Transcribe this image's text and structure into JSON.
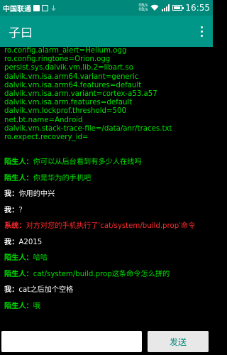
{
  "status_bar": {
    "carrier": "中国联通",
    "network_rate_top": "0B/s",
    "network_rate_bottom": "0B/s",
    "time": "16:55",
    "icons": [
      "check-square-icon",
      "check-square-icon",
      "usb-icon",
      "wifi-icon",
      "signal-icon",
      "battery-icon"
    ]
  },
  "app_bar": {
    "title": "子曰"
  },
  "props_lines": [
    "ro.config.alarm_alert=Helium.ogg",
    "ro.config.ringtone=Orion.ogg",
    "persist.sys.dalvik.vm.lib.2=libart.so",
    "dalvik.vm.isa.arm64.variant=generic",
    "dalvik.vm.isa.arm64.features=default",
    "dalvik.vm.isa.arm.variant=cortex-a53.a57",
    "dalvik.vm.isa.arm.features=default",
    "dalvik.vm.lockprof.threshold=500",
    "net.bt.name=Android",
    "dalvik.vm.stack-trace-file=/data/anr/traces.txt",
    "ro.expect.recovery_id="
  ],
  "messages": [
    {
      "sender": "陌生人：",
      "text": "你可以从后台看到有多少人在线吗",
      "type": "stranger"
    },
    {
      "sender": "陌生人：",
      "text": "你是华为的手机吧",
      "type": "stranger"
    },
    {
      "sender": "我：",
      "text": "你用的中兴",
      "type": "me"
    },
    {
      "sender": "我：",
      "text": "？",
      "type": "me"
    },
    {
      "sender": "系统：",
      "text": "对方对您的手机执行了'cat/system/build.prop'命令",
      "type": "system"
    },
    {
      "sender": "我：",
      "text": "A2015",
      "type": "me"
    },
    {
      "sender": "陌生人：",
      "text": "哈哈",
      "type": "stranger"
    },
    {
      "sender": "陌生人：",
      "text": "cat/system/build.prop这条命令怎么拼的",
      "type": "stranger"
    },
    {
      "sender": "我：",
      "text": "cat之后加个空格",
      "type": "me"
    },
    {
      "sender": "陌生人：",
      "text": "哦",
      "type": "stranger"
    }
  ],
  "input": {
    "value": "",
    "placeholder": ""
  },
  "send_button": {
    "label": "发送"
  },
  "colors": {
    "status_bar": "#00897b",
    "app_bar": "#009688",
    "stranger_text": "#00e000",
    "me_text": "#ffffff",
    "system_text": "#ff2b2b"
  }
}
